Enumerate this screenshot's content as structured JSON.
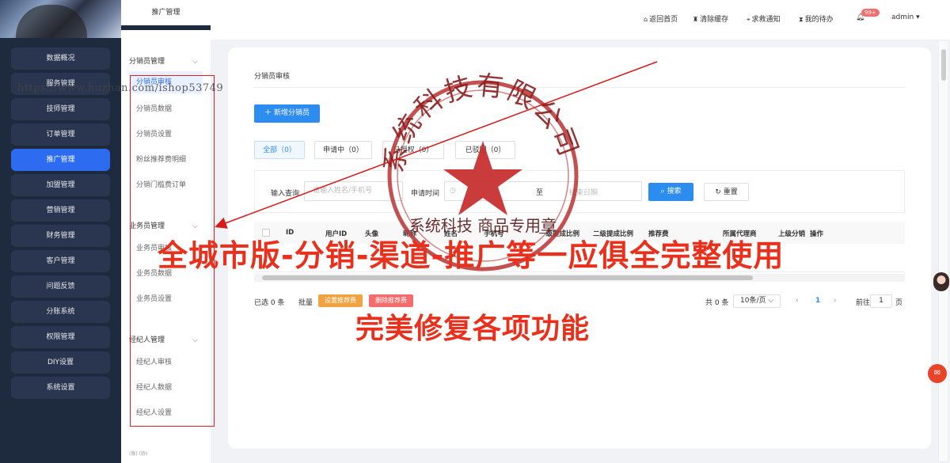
{
  "sidebar": {
    "items": [
      {
        "label": "数据概况"
      },
      {
        "label": "服务管理"
      },
      {
        "label": "技师管理"
      },
      {
        "label": "订单管理"
      },
      {
        "label": "推广管理"
      },
      {
        "label": "加盟管理"
      },
      {
        "label": "营销管理"
      },
      {
        "label": "财务管理"
      },
      {
        "label": "客户管理"
      },
      {
        "label": "问题反馈"
      },
      {
        "label": "分账系统"
      },
      {
        "label": "权限管理"
      },
      {
        "label": "DIY设置"
      },
      {
        "label": "系统设置"
      }
    ],
    "active_index": 4
  },
  "subnav": {
    "title": "推广管理",
    "groups": [
      {
        "title": "分销员管理",
        "items": [
          "分销员审核",
          "分销员数据",
          "分销员设置",
          "粉丝推荐费明细",
          "分销门槛费订单"
        ]
      },
      {
        "title": "业务员管理",
        "items": [
          "业务员审核",
          "业务员数据",
          "业务员设置"
        ]
      },
      {
        "title": "经纪人管理",
        "items": [
          "经纪人审核",
          "经纪人数据",
          "经纪人设置"
        ]
      }
    ],
    "chevron": "⌵",
    "footer": "(版)   (协)"
  },
  "header": {
    "home": "返回首页",
    "clear_cache": "清除缓存",
    "help": "求救通知",
    "todo": "我的待办",
    "badge": "99+",
    "user": "admin"
  },
  "page": {
    "breadcrumb": "分销员审核",
    "add_button": "新增分销员",
    "tabs": [
      "全部（0）",
      "申请中（0）",
      "已授权（0）",
      "已驳回（0）"
    ],
    "filter": {
      "query_label": "输入查询",
      "query_placeholder": "请输入姓名/手机号",
      "time_label": "申请时间",
      "start_placeholder": "",
      "to": "至",
      "end_placeholder": "结束日期",
      "search": "搜索",
      "reset": "重置"
    },
    "columns": [
      "ID",
      "用户ID",
      "头像",
      "昵称",
      "姓名",
      "手机号",
      "一级提成比例",
      "二级提成比例",
      "推荐费",
      "所属代理商",
      "上级分销",
      "操作"
    ],
    "footer": {
      "selected": "已选 0 条",
      "batch": "批量",
      "set_fee": "设置推荐费",
      "delete_fee": "删除推荐费",
      "total": "共 0 条",
      "page_size": "10条/页",
      "current_page": "1",
      "goto_label": "前往",
      "goto_value": "1",
      "page_suffix": "页"
    }
  },
  "watermark": {
    "url": "https://www.huzhan.com/ishop53749",
    "seal_top": "系统科技有限公司",
    "seal_mid": "系统科技",
    "seal_bottom": "商品专用章"
  },
  "overlay": {
    "headline": "全城市版-分销-渠道-推广等一应俱全完整使用",
    "subline": "完美修复各项功能"
  },
  "colors": {
    "accent": "#2d8cf0",
    "sidebar": "#1e2a3e",
    "overlay_red": "#e8301c",
    "orange": "#f0a341",
    "pink": "#f56c6c"
  }
}
